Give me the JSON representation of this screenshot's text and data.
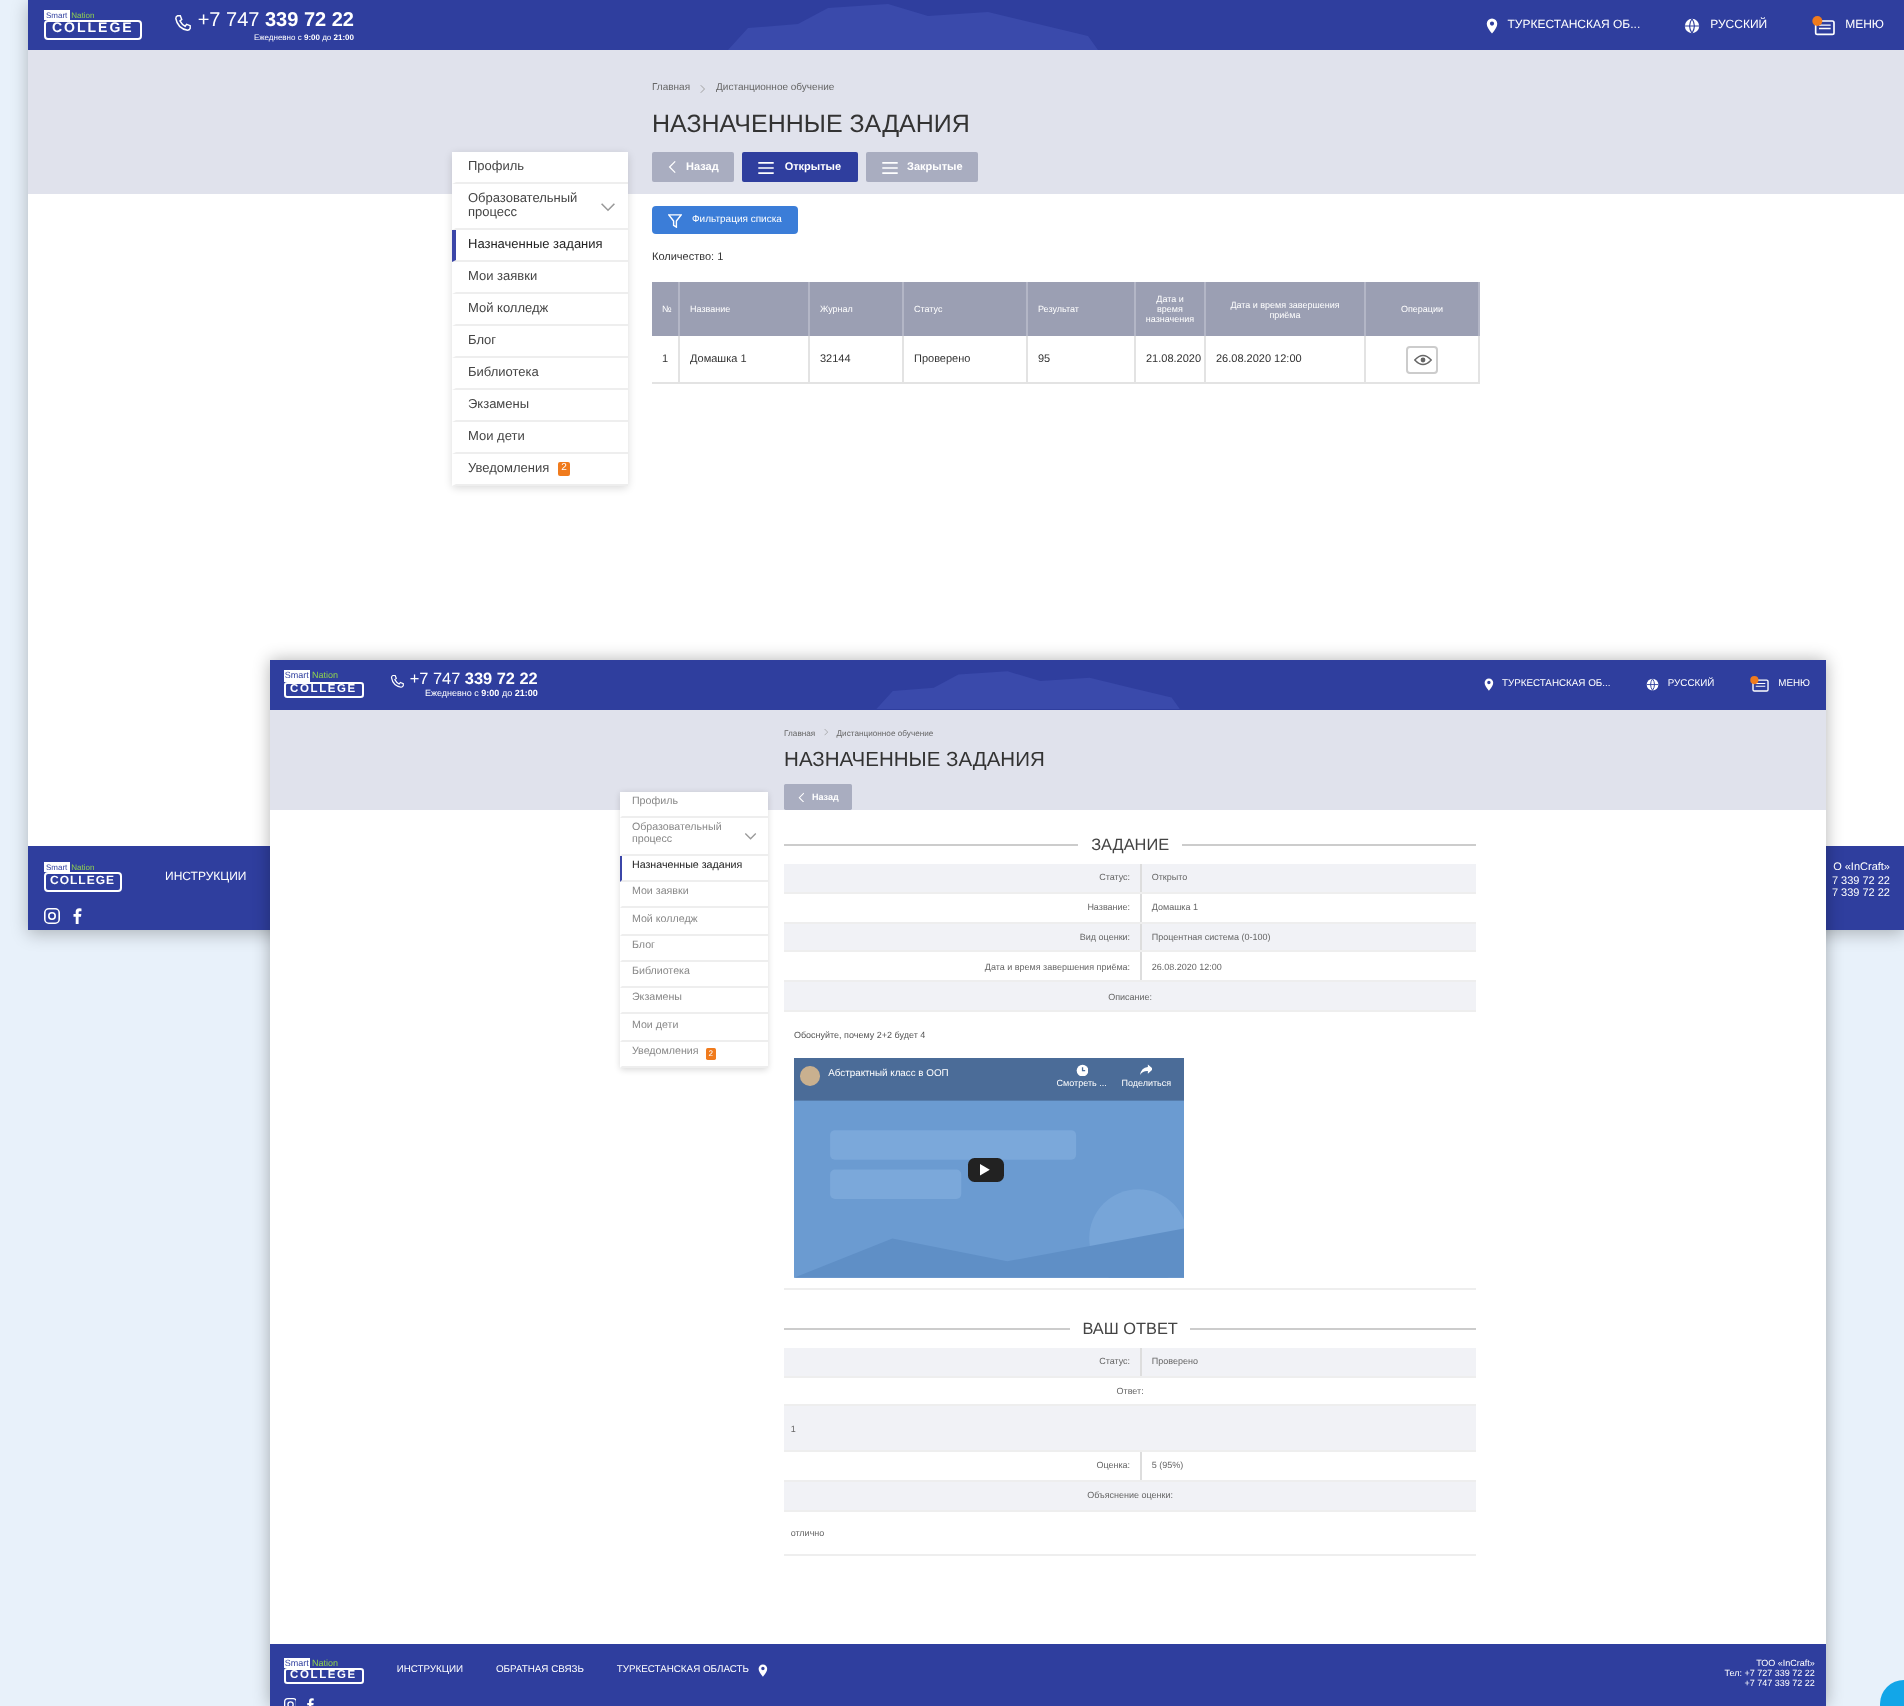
{
  "background_window": {
    "header": {
      "logo": {
        "small_left": "Smart",
        "small_right": "Nation",
        "main": "COLLEGE"
      },
      "phone": "+7 747 **339 72 22**",
      "hours": "Ежедневно с **9:00** до **21:00**",
      "region": "ТУРКЕСТАНСКАЯ ОБ...",
      "language": "РУССКИЙ",
      "menu": "МЕНЮ"
    },
    "breadcrumb": [
      "Главная",
      "Дистанционное обучение"
    ],
    "title": "НАЗНАЧЕННЫЕ ЗАДАНИЯ",
    "buttons": [
      {
        "kind": "back",
        "label": "Назад",
        "selected": false
      },
      {
        "kind": "tab",
        "label": "Открытые",
        "selected": true
      },
      {
        "kind": "tab",
        "label": "Закрытые",
        "selected": false
      }
    ],
    "sidebar": [
      {
        "kind": "link",
        "label": "Профиль",
        "selected": false
      },
      {
        "kind": "group",
        "label": "Образовательный процесс",
        "selected": false,
        "expanded": false
      },
      {
        "kind": "link",
        "label": "Назначенные задания",
        "selected": true
      },
      {
        "kind": "link",
        "label": "Мои заявки",
        "selected": false
      },
      {
        "kind": "link",
        "label": "Мой колледж",
        "selected": false
      },
      {
        "kind": "link",
        "label": "Блог",
        "selected": false
      },
      {
        "kind": "link",
        "label": "Библиотека",
        "selected": false
      },
      {
        "kind": "link",
        "label": "Экзамены",
        "selected": false
      },
      {
        "kind": "link",
        "label": "Мои дети",
        "selected": false
      },
      {
        "kind": "link",
        "label": "Уведомления",
        "selected": false,
        "badge": "2"
      }
    ],
    "filter_button": "Фильтрация списка",
    "count": "Количество: 1",
    "table": {
      "columns": [
        "№",
        "Название",
        "Журнал",
        "Статус",
        "Результат",
        "Дата и время назначения",
        "Дата и время завершения приёма",
        "Операции"
      ],
      "rows": [
        {
          "cells": [
            "1",
            "Домашка 1",
            "32144",
            "Проверено",
            "95",
            "21.08.2020",
            "26.08.2020 12:00"
          ],
          "actions": [
            {
              "kind": "view"
            }
          ]
        }
      ]
    },
    "footer": {
      "logo": {
        "small_left": "Smart",
        "small_right": "Nation",
        "main": "COLLEGE"
      },
      "links": [
        {
          "label": "ИНСТРУКЦИИ"
        }
      ],
      "company": [
        "О «InCraft»",
        "7 339 72 22",
        "7 339 72 22"
      ]
    }
  },
  "front_window": {
    "header": {
      "logo": {
        "small_left": "Smart",
        "small_right": "Nation",
        "main": "COLLEGE"
      },
      "phone": "+7 747 **339 72 22**",
      "hours": "Ежедневно с **9:00** до **21:00**",
      "region": "ТУРКЕСТАНСКАЯ ОБ...",
      "language": "РУССКИЙ",
      "menu": "МЕНЮ"
    },
    "breadcrumb": [
      "Главная",
      "Дистанционное обучение"
    ],
    "title": "НАЗНАЧЕННЫЕ ЗАДАНИЯ",
    "buttons": [
      {
        "kind": "back",
        "label": "Назад",
        "selected": false
      }
    ],
    "sidebar": [
      {
        "kind": "link",
        "label": "Профиль",
        "selected": false
      },
      {
        "kind": "group",
        "label": "Образовательный процесс",
        "selected": false,
        "expanded": false
      },
      {
        "kind": "link",
        "label": "Назначенные задания",
        "selected": true
      },
      {
        "kind": "link",
        "label": "Мои заявки",
        "selected": false
      },
      {
        "kind": "link",
        "label": "Мой колледж",
        "selected": false
      },
      {
        "kind": "link",
        "label": "Блог",
        "selected": false
      },
      {
        "kind": "link",
        "label": "Библиотека",
        "selected": false
      },
      {
        "kind": "link",
        "label": "Экзамены",
        "selected": false
      },
      {
        "kind": "link",
        "label": "Мои дети",
        "selected": false
      },
      {
        "kind": "link",
        "label": "Уведомления",
        "selected": false,
        "badge": "2"
      }
    ],
    "task": {
      "heading": "ЗАДАНИЕ",
      "rows": [
        {
          "kind": "pair",
          "label": "Статус:",
          "value": "Открыто"
        },
        {
          "kind": "pair",
          "label": "Название:",
          "value": "Домашка 1"
        },
        {
          "kind": "pair",
          "label": "Вид оценки:",
          "value": "Процентная система (0-100)"
        },
        {
          "kind": "pair",
          "label": "Дата и время завершения приёма:",
          "value": "26.08.2020 12:00"
        },
        {
          "kind": "heading",
          "label": "Описание:"
        }
      ]
    },
    "description": "Обоснуйте, почему 2+2 будет 4",
    "video": {
      "title": "Абстрактный класс в ООП",
      "watch_later": "Смотреть ...",
      "share": "Поделиться"
    },
    "answer": {
      "heading": "ВАШ ОТВЕТ",
      "rows": [
        {
          "kind": "pair",
          "label": "Статус:",
          "value": "Проверено"
        },
        {
          "kind": "heading",
          "label": "Ответ:"
        },
        {
          "kind": "text",
          "value": "1"
        },
        {
          "kind": "pair",
          "label": "Оценка:",
          "value": "5 (95%)"
        },
        {
          "kind": "heading",
          "label": "Объяснение оценки:"
        },
        {
          "kind": "text",
          "value": "отлично"
        }
      ]
    },
    "footer": {
      "logo": {
        "small_left": "Smart",
        "small_right": "Nation",
        "main": "COLLEGE"
      },
      "links": [
        {
          "label": "ИНСТРУКЦИИ"
        },
        {
          "label": "ОБРАТНАЯ СВЯЗЬ"
        },
        {
          "label": "ТУРКЕСТАНСКАЯ ОБЛАСТЬ",
          "pin": true
        }
      ],
      "company": [
        "ТОО «InCraft»",
        "Тел: +7 727 339 72 22",
        "+7 747 339 72 22"
      ]
    }
  }
}
